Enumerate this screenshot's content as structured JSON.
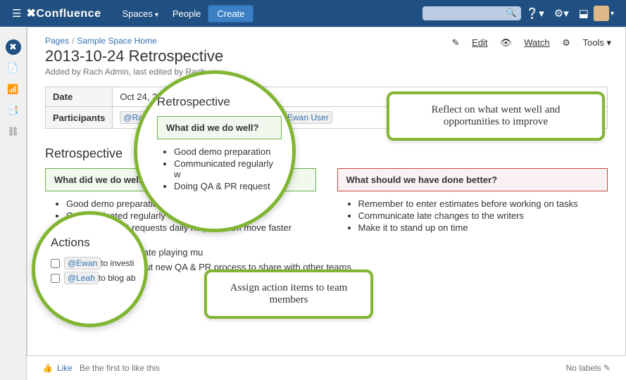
{
  "topbar": {
    "logo": "Confluence",
    "spaces": "Spaces",
    "people": "People",
    "create": "Create"
  },
  "breadcrumbs": {
    "pages": "Pages",
    "space": "Sample Space Home"
  },
  "page": {
    "title": "2013-10-24 Retrospective",
    "byline": "Added by Rach Admin, last edited by Rach"
  },
  "page_actions": {
    "edit": "Edit",
    "watch": "Watch",
    "tools": "Tools"
  },
  "meta": {
    "date_k": "Date",
    "date_v": "Oct 24, 2",
    "part_k": "Participants",
    "p1": "@Ra",
    "p2": "Ewan User"
  },
  "retro": {
    "heading": "Retrospective",
    "well_q": "What did we do well?",
    "better_q": "What should we have done better?",
    "well_items": [
      "Good demo preparation",
      "Communicated regularly with other teams",
      "Doing QA & PR requests daily helped team move faster"
    ],
    "better_items": [
      "Remember to enter estimates before working on tasks",
      "Communicate late changes to the writers",
      "Make it to stand up on time"
    ]
  },
  "actions": {
    "heading": "Actions",
    "row1_user": "@Ewan",
    "row1_text": " to investigate playing mu",
    "row2_user": "@Leah",
    "row2_text": " to blog about new QA & PR process to share with other teams",
    "like": "Like"
  },
  "zoom1": {
    "heading": "Retrospective",
    "panel": "What did we do well?",
    "items": [
      "Good demo preparation",
      "Communicated regularly w",
      "Doing QA & PR request"
    ]
  },
  "zoom2": {
    "heading": "Actions",
    "u1": "@Ewan",
    "t1": " to investi",
    "u2": "@Leah",
    "t2": " to blog ab"
  },
  "callouts": {
    "reflect": "Reflect on what went well and opportunities to improve",
    "assign": "Assign action items to team members"
  },
  "footer": {
    "like": "Like",
    "first": "Be the first to like this",
    "nolabels": "No labels"
  }
}
